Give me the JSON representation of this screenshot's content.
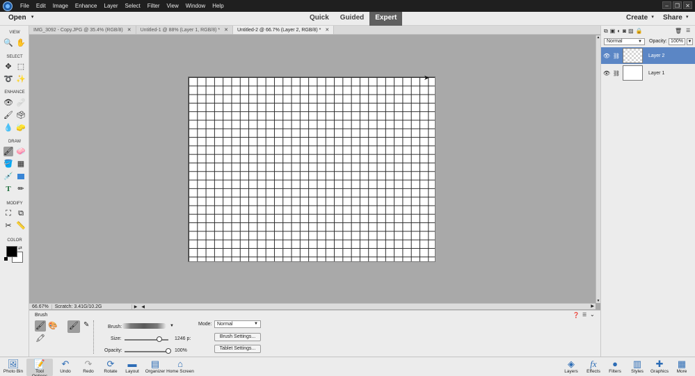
{
  "menu": {
    "items": [
      "File",
      "Edit",
      "Image",
      "Enhance",
      "Layer",
      "Select",
      "Filter",
      "View",
      "Window",
      "Help"
    ],
    "window_controls": [
      "–",
      "❐",
      "✕"
    ]
  },
  "modebar": {
    "open_label": "Open",
    "modes": [
      "Quick",
      "Guided",
      "Expert"
    ],
    "active_mode": "Expert",
    "create_label": "Create",
    "share_label": "Share"
  },
  "doc_tabs": [
    {
      "title": "IMG_3092 - Copy.JPG @ 35.4% (RGB/8)",
      "active": false
    },
    {
      "title": "Untitled-1 @ 88% (Layer 1, RGB/8) *",
      "active": false
    },
    {
      "title": "Untitled-2 @ 66.7% (Layer 2, RGB/8) *",
      "active": true
    }
  ],
  "toolbar": {
    "sections": {
      "view": "VIEW",
      "select": "SELECT",
      "enhance": "ENHANCE",
      "draw": "DRAW",
      "modify": "MODIFY",
      "color": "COLOR"
    },
    "selected_tool": "brush",
    "foreground_color": "#000000",
    "background_color": "#ffffff"
  },
  "status": {
    "zoom": "66.67%",
    "scratch": "Scratch: 3.41G/10.2G"
  },
  "tool_options": {
    "title": "Brush",
    "brush_label": "Brush:",
    "size_label": "Size:",
    "size_value": "1246 p:",
    "size_level": 0.8,
    "opacity_label": "Opacity:",
    "opacity_value": "100%",
    "opacity_level": 1.0,
    "mode_label": "Mode:",
    "mode_value": "Normal",
    "brush_settings_label": "Brush Settings...",
    "tablet_settings_label": "Tablet Settings..."
  },
  "layers_panel": {
    "blend_mode": "Normal",
    "opacity_label": "Opacity:",
    "opacity_value": "100%",
    "layers": [
      {
        "name": "Layer 2",
        "selected": true,
        "transparent": true
      },
      {
        "name": "Layer 1",
        "selected": false,
        "transparent": false
      }
    ],
    "selection_color": "#5b86c5"
  },
  "bottom_bar": {
    "left": [
      "Photo Bin",
      "Tool Options",
      "Undo",
      "Redo",
      "Rotate",
      "Layout",
      "Organizer",
      "Home Screen"
    ],
    "right": [
      "Layers",
      "Effects",
      "Filters",
      "Styles",
      "Graphics",
      "More"
    ]
  }
}
